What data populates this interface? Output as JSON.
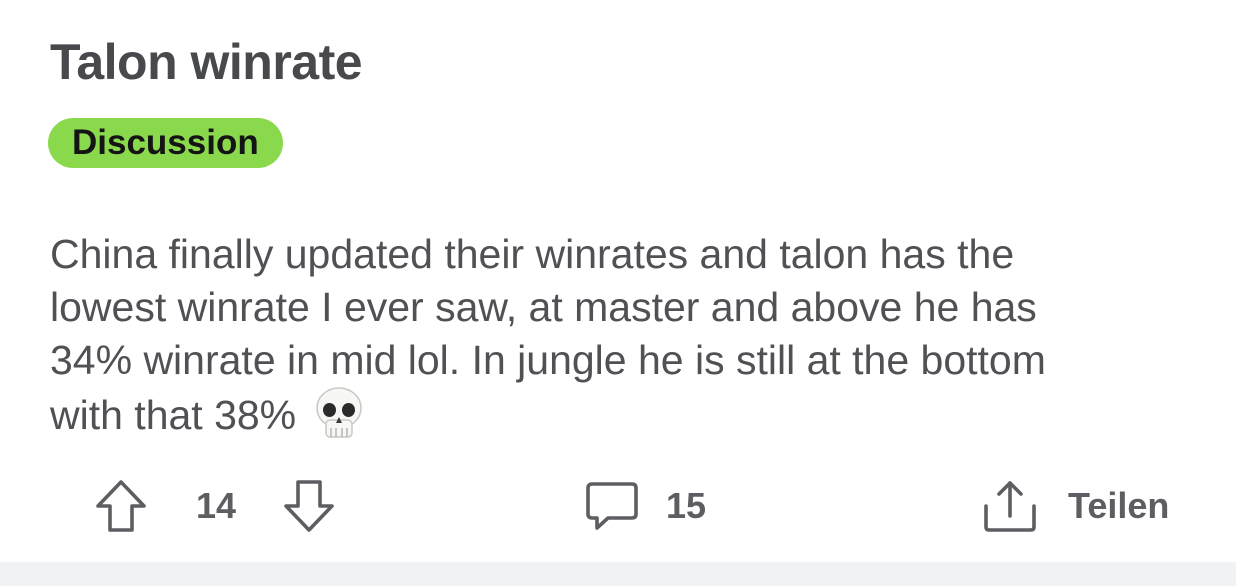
{
  "post": {
    "title": "Talon winrate",
    "flair": {
      "label": "Discussion",
      "color": "#8ad94d"
    },
    "body_lines": [
      "China finally updated their winrates and talon has the",
      "lowest winrate I ever saw, at master and above he has",
      "34% winrate in mid lol. In jungle he is still at the bottom",
      "with that 38%"
    ],
    "body_emoji": "skull-emoji"
  },
  "actions": {
    "upvote_icon": "arrow-up-icon",
    "vote_count": "14",
    "downvote_icon": "arrow-down-icon",
    "comment_icon": "speech-bubble-icon",
    "comment_count": "15",
    "share_icon": "share-upload-icon",
    "share_label": "Teilen"
  },
  "colors": {
    "text": "#48494d",
    "icon": "#5d5e62",
    "footer_bg": "#f1f2f4"
  }
}
